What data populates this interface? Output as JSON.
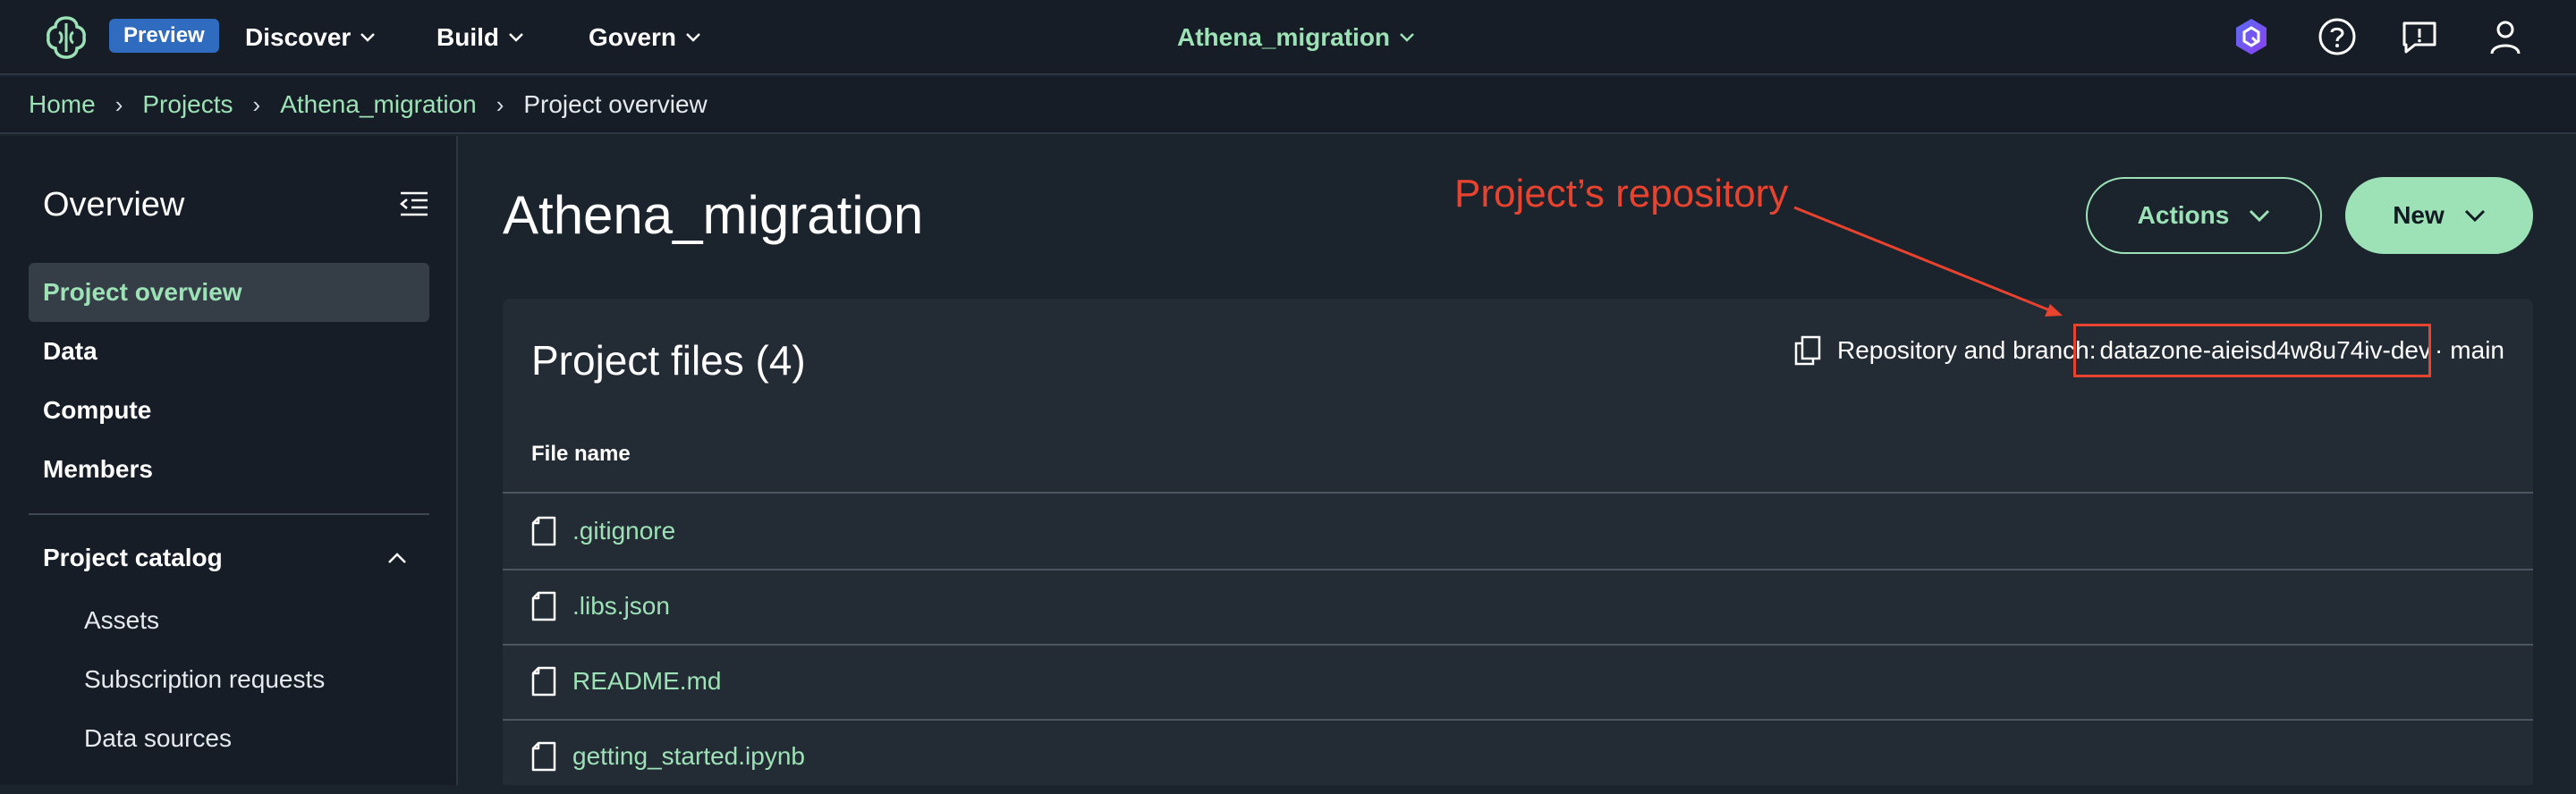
{
  "topbar": {
    "preview_badge": "Preview",
    "nav": [
      {
        "label": "Discover"
      },
      {
        "label": "Build"
      },
      {
        "label": "Govern"
      }
    ],
    "project_switcher": "Athena_migration",
    "icons": [
      "app-logo-icon",
      "amazon-q-icon",
      "help-icon",
      "feedback-icon",
      "user-profile-icon"
    ]
  },
  "breadcrumb": {
    "items": [
      "Home",
      "Projects",
      "Athena_migration"
    ],
    "current": "Project overview"
  },
  "sidebar": {
    "title": "Overview",
    "items": [
      {
        "label": "Project overview",
        "active": true
      },
      {
        "label": "Data"
      },
      {
        "label": "Compute"
      },
      {
        "label": "Members"
      }
    ],
    "section": {
      "label": "Project catalog",
      "expanded": true,
      "items": [
        "Assets",
        "Subscription requests",
        "Data sources"
      ]
    }
  },
  "main": {
    "title": "Athena_migration",
    "actions_label": "Actions",
    "new_label": "New",
    "panel": {
      "title": "Project files (4)",
      "repo_label": "Repository and branch:",
      "repo_name": "datazone-aieisd4w8u74iv-dev",
      "branch_sep": "·",
      "branch": "main",
      "column_header": "File name",
      "files": [
        ".gitignore",
        ".libs.json",
        "README.md",
        "getting_started.ipynb"
      ]
    }
  },
  "annotation": {
    "label": "Project’s repository",
    "color": "#e8432e"
  },
  "colors": {
    "accent": "#9de2b6",
    "background": "#1b232d",
    "nav_bg": "#161d26",
    "badge": "#2f6bbf"
  }
}
